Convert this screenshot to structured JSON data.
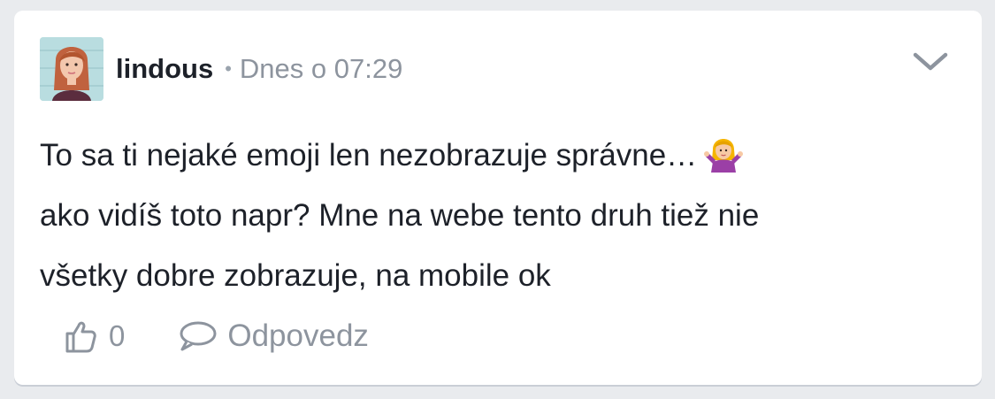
{
  "post": {
    "author": "lindous",
    "separator": "•",
    "timestamp": "Dnes o 07:29",
    "text_line1": "To sa ti nejaké emoji len nezobrazuje správne…",
    "text_line2": "ako vidíš toto napr? Mne na webe tento druh tiež nie",
    "text_line3": "všetky dobre zobrazuje, na mobile ok",
    "emoji": "woman-shrugging-emoji",
    "likes": "0",
    "reply_label": "Odpovedz"
  },
  "icons": {
    "menu": "chevron-down-icon",
    "like": "thumbs-up-icon",
    "reply": "speech-bubble-icon"
  },
  "colors": {
    "background": "#e9ebee",
    "card": "#ffffff",
    "text": "#1d2129",
    "muted": "#8d949e"
  }
}
